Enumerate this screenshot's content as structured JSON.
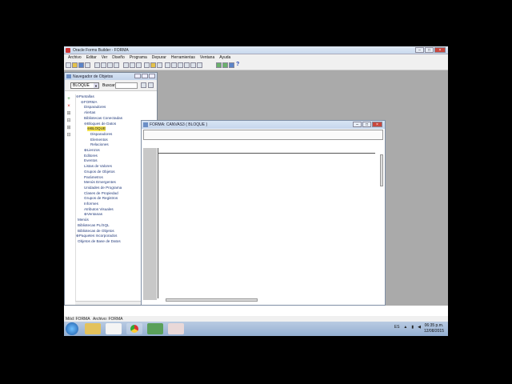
{
  "window": {
    "title": "Oracle Forms Builder - FORMA"
  },
  "menu": [
    "Archivo",
    "Editar",
    "Ver",
    "Diseño",
    "Programa",
    "Depurar",
    "Herramientas",
    "Ventana",
    "Ayuda"
  ],
  "help_icon": "?",
  "navigator": {
    "title": "Navegador de Objetos",
    "selector_value": "BLOQUE",
    "search_label": "Buscar:",
    "tree": [
      {
        "label": "Pantallas",
        "prefix": "⊖"
      },
      {
        "label": "FORMA",
        "prefix": "⊖"
      },
      {
        "label": "Disparadores",
        "prefix": ""
      },
      {
        "label": "Alertas",
        "prefix": ""
      },
      {
        "label": "Bibliotecas Conectadas",
        "prefix": ""
      },
      {
        "label": "Bloques de Datos",
        "prefix": "⊖"
      },
      {
        "label": "BLOQUE",
        "prefix": "⊖"
      },
      {
        "label": "Disparadores",
        "prefix": ""
      },
      {
        "label": "Elementos",
        "prefix": ""
      },
      {
        "label": "Relaciones",
        "prefix": ""
      },
      {
        "label": "Lienzos",
        "prefix": "⊕"
      },
      {
        "label": "Editores",
        "prefix": ""
      },
      {
        "label": "Eventos",
        "prefix": ""
      },
      {
        "label": "Listas de Valores",
        "prefix": ""
      },
      {
        "label": "Grupos de Objetos",
        "prefix": ""
      },
      {
        "label": "Parámetros",
        "prefix": ""
      },
      {
        "label": "Menús Emergentes",
        "prefix": ""
      },
      {
        "label": "Unidades de Programa",
        "prefix": ""
      },
      {
        "label": "Clases de Propiedad",
        "prefix": ""
      },
      {
        "label": "Grupos de Registros",
        "prefix": ""
      },
      {
        "label": "Informes",
        "prefix": ""
      },
      {
        "label": "Atributos Visuales",
        "prefix": ""
      },
      {
        "label": "Ventanas",
        "prefix": "⊕"
      },
      {
        "label": "Menús",
        "prefix": ""
      },
      {
        "label": "Bibliotecas PL/SQL",
        "prefix": ""
      },
      {
        "label": "Bibliotecas de Objetos",
        "prefix": ""
      },
      {
        "label": "Paquetes Incorporados",
        "prefix": "⊕"
      },
      {
        "label": "Objetos de Base de Datos",
        "prefix": ""
      }
    ]
  },
  "canvas_window": {
    "title": "FORMA: CANVAS3 ( BLOQUE )"
  },
  "status": {
    "mod": "Mód: FORMA",
    "file": "Archivo: FORMA"
  },
  "taskbar": {
    "lang": "ES",
    "time": "06:35 p.m.",
    "date": "12/08/2015"
  }
}
